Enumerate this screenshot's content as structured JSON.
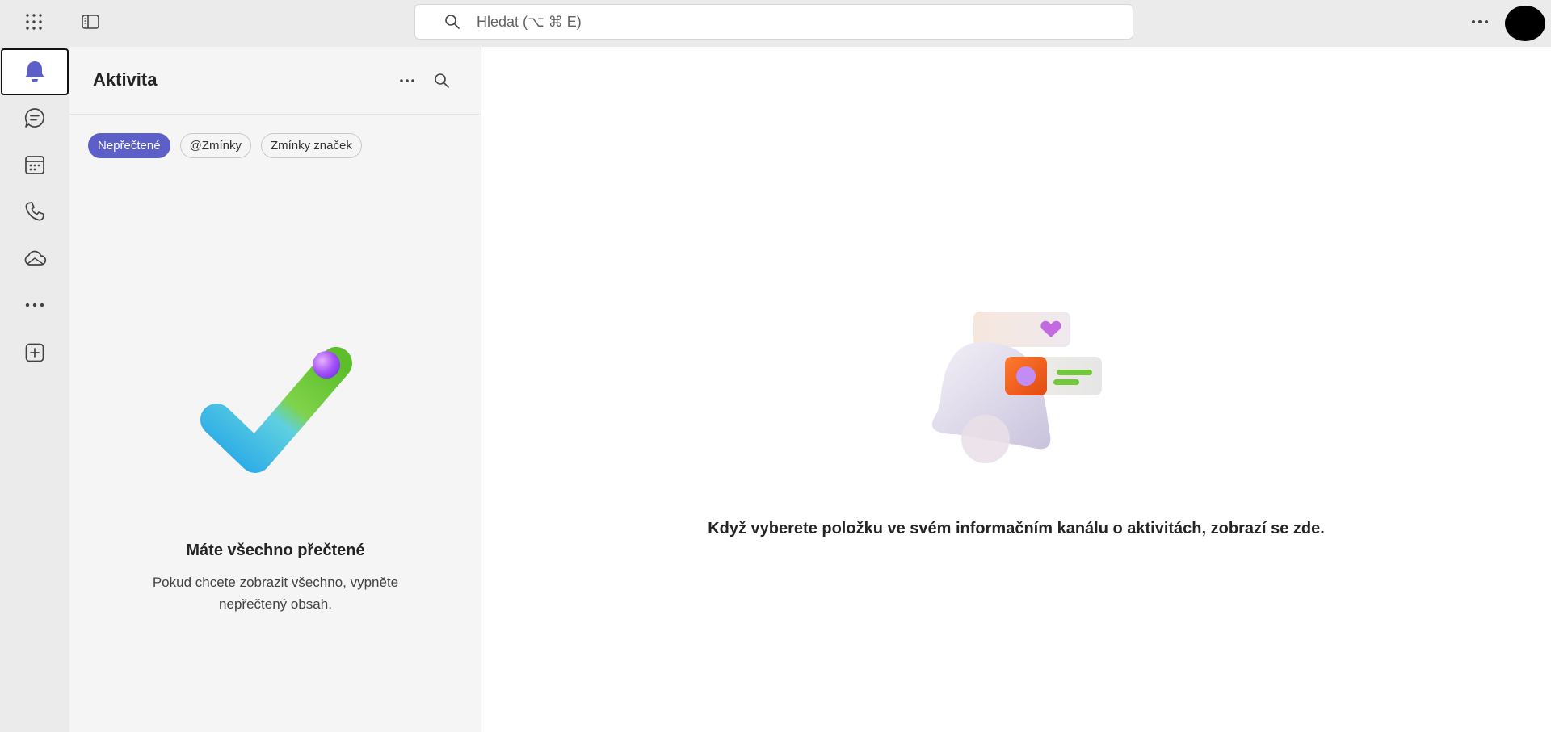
{
  "topbar": {
    "search_placeholder": "Hledat (⌥ ⌘ E)"
  },
  "rail": {
    "items": [
      {
        "icon": "bell-icon",
        "active": true
      },
      {
        "icon": "chat-icon"
      },
      {
        "icon": "calendar-icon"
      },
      {
        "icon": "phone-icon"
      },
      {
        "icon": "onedrive-cloud-icon"
      },
      {
        "icon": "more-apps-icon"
      },
      {
        "icon": "add-app-icon"
      }
    ]
  },
  "panel": {
    "title": "Aktivita",
    "filters": [
      {
        "label": "Nepřečtené",
        "active": true
      },
      {
        "label": "@Zmínky",
        "active": false
      },
      {
        "label": "Zmínky značek",
        "active": false
      }
    ],
    "empty_title": "Máte všechno přečtené",
    "empty_desc": "Pokud chcete zobrazit všechno, vypněte nepřečtený obsah."
  },
  "main": {
    "message": "Když vyberete položku ve svém informačním kanálu o aktivitách, zobrazí se zde."
  },
  "colors": {
    "accent": "#5b5fc7",
    "rail_bg": "#ebebeb",
    "panel_bg": "#f5f5f5"
  }
}
